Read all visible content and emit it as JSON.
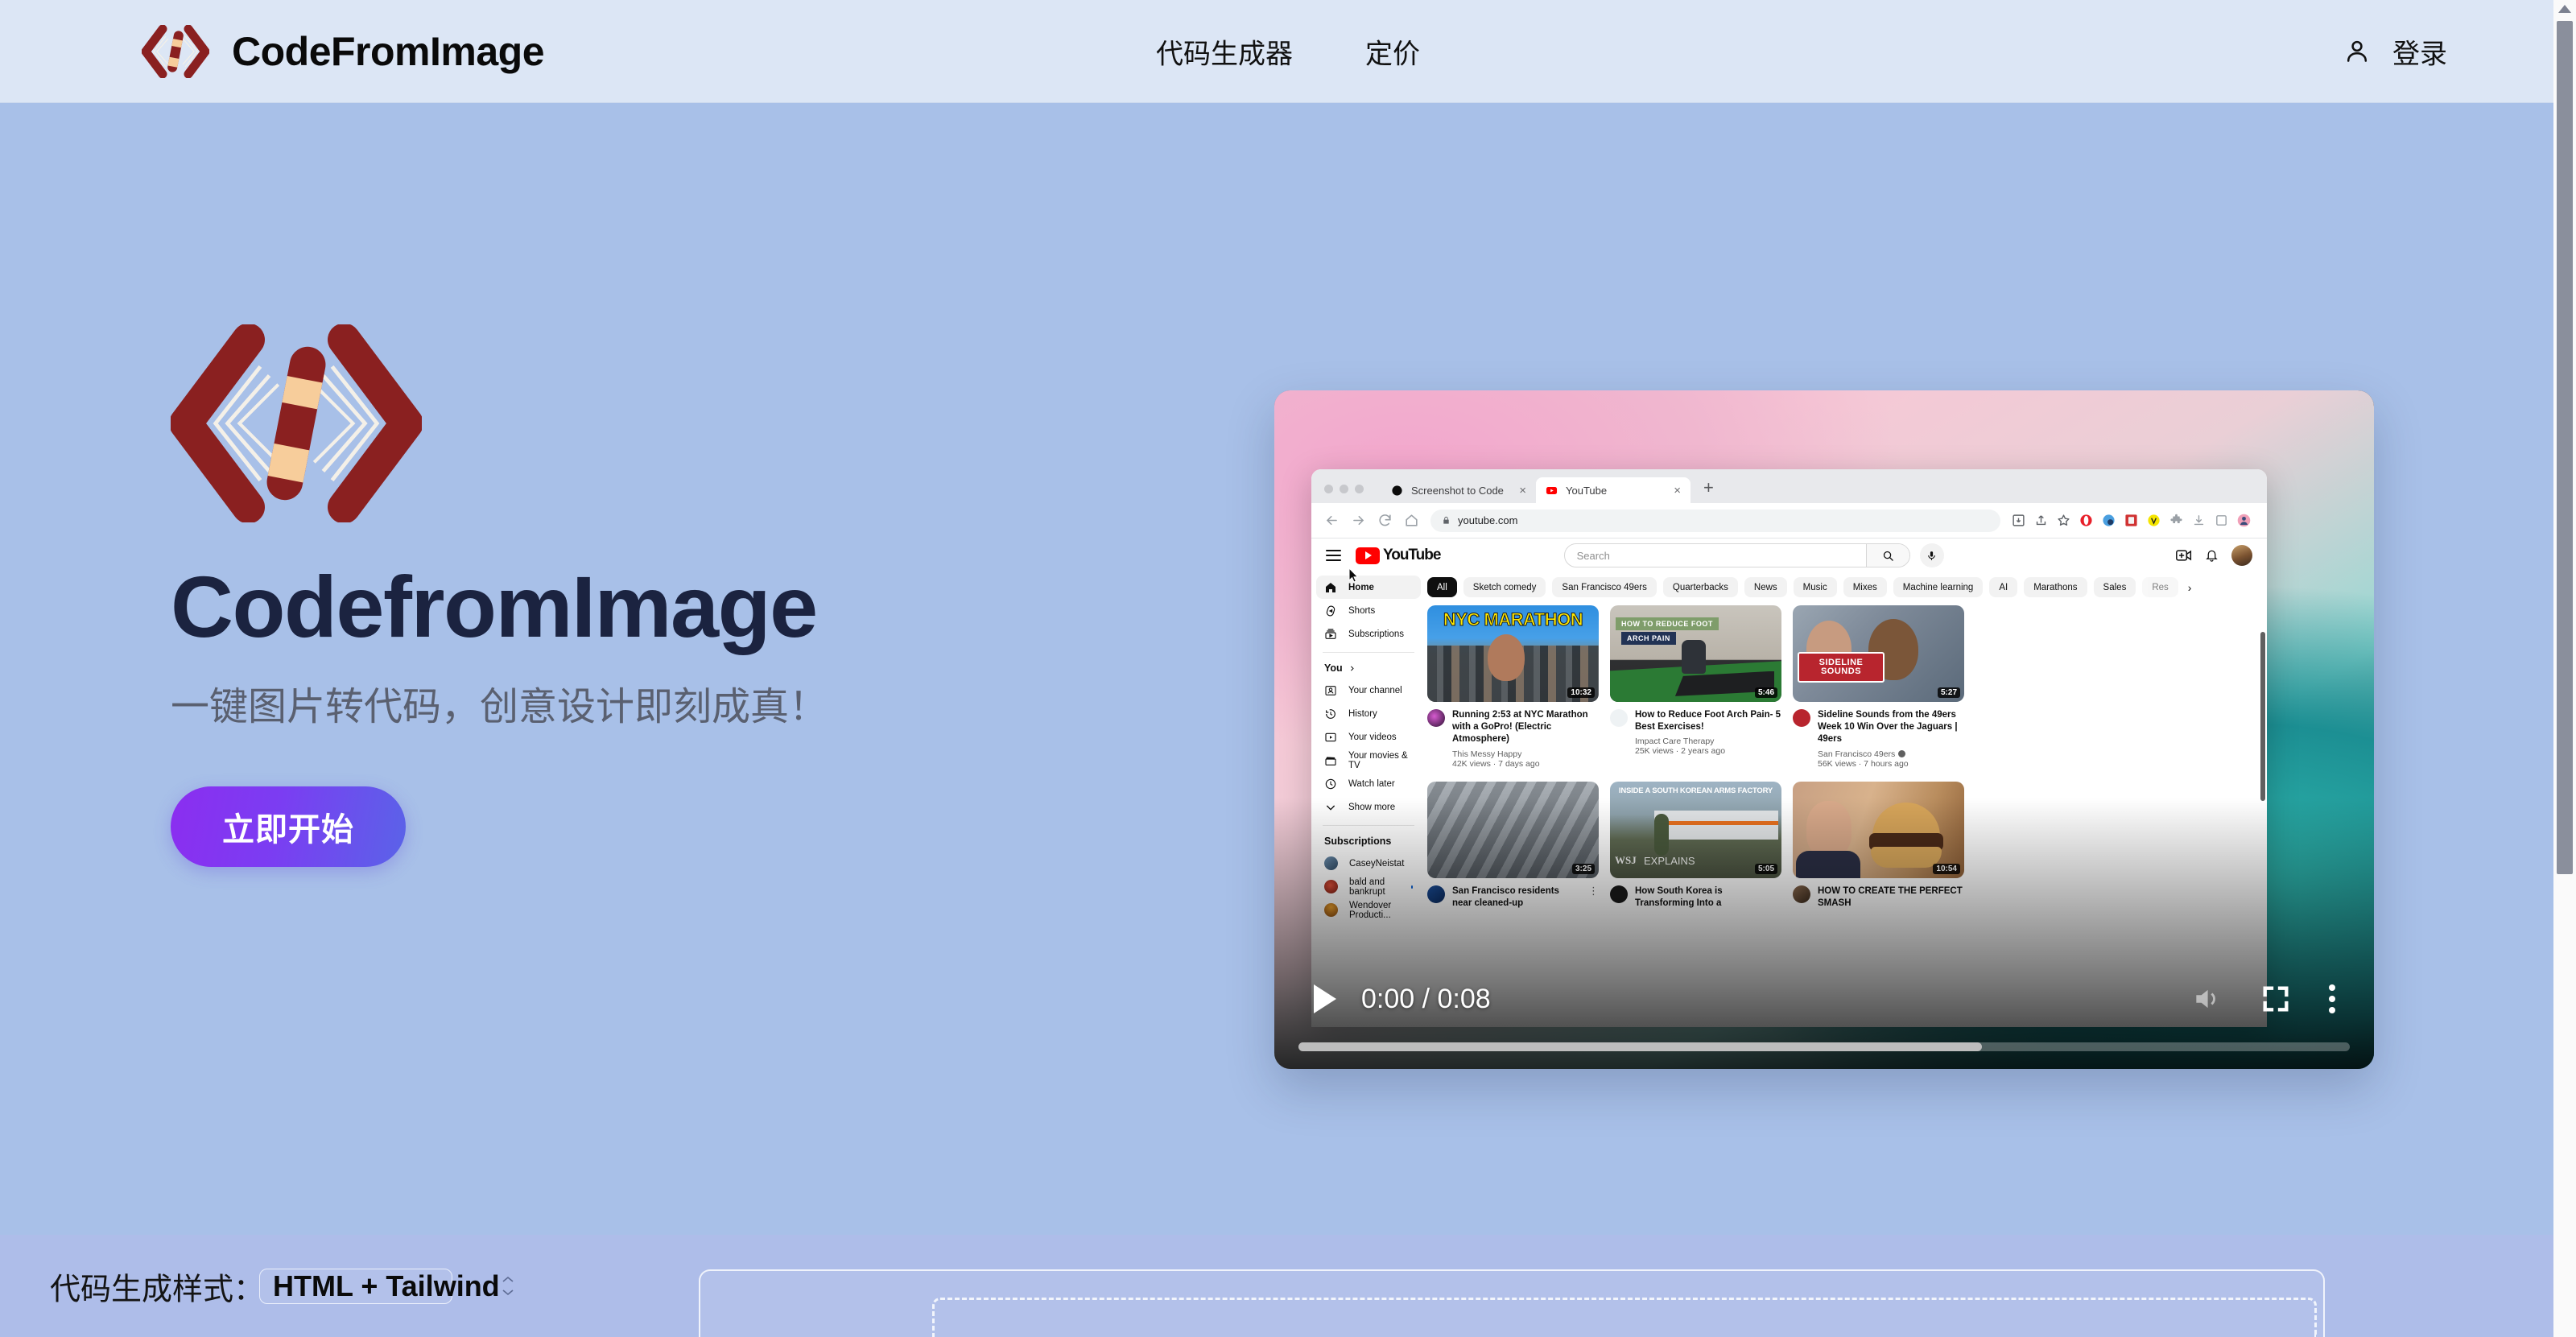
{
  "header": {
    "brand_name": "CodeFromImage",
    "logo_icon": "code-brackets-pencil-logo",
    "nav": [
      {
        "label": "代码生成器",
        "name": "nav-code-generator"
      },
      {
        "label": "定价",
        "name": "nav-pricing"
      }
    ],
    "login": {
      "label": "登录",
      "icon": "user-icon"
    }
  },
  "hero": {
    "logo_icon": "code-brackets-pencil-logo",
    "title": "CodefromImage",
    "subtitle": "一键图片转代码，创意设计即刻成真！",
    "cta_label": "立即开始"
  },
  "video": {
    "current_time": "0:00",
    "duration": "0:08",
    "time_display": "0:00 / 0:08",
    "progress_percent": 0,
    "buffered_percent": 65,
    "play_icon": "play-icon",
    "volume_icon": "volume-muted-icon",
    "fullscreen_icon": "fullscreen-icon",
    "menu_icon": "kebab-menu-icon",
    "browser": {
      "tabs": [
        {
          "title": "Screenshot to Code",
          "favicon": "black-circle-favicon",
          "active": false
        },
        {
          "title": "YouTube",
          "favicon": "youtube-favicon",
          "active": true
        }
      ],
      "new_tab_label": "+",
      "url": "youtube.com",
      "lock_icon": "lock-icon",
      "nav_icons": [
        "back-icon",
        "forward-icon",
        "reload-icon",
        "home-icon"
      ],
      "toolbar_icons": [
        "install-icon",
        "share-icon",
        "bookmark-star-icon",
        "opera-ext-icon",
        "privacy-ext-icon",
        "reader-ext-icon",
        "v-ext-icon",
        "puzzle-ext-icon",
        "download-icon",
        "sidebar-icon",
        "profile-avatar"
      ]
    },
    "youtube": {
      "logo_text": "YouTube",
      "menu_icon": "hamburger-menu-icon",
      "search_placeholder": "Search",
      "search_icon": "search-icon",
      "mic_icon": "microphone-icon",
      "create_icon": "create-video-icon",
      "bell_icon": "notifications-bell-icon",
      "avatar_icon": "account-avatar",
      "sidebar": [
        {
          "label": "Home",
          "icon": "home-icon",
          "active": true
        },
        {
          "label": "Shorts",
          "icon": "shorts-icon",
          "active": false
        },
        {
          "label": "Subscriptions",
          "icon": "subscriptions-icon",
          "active": false
        }
      ],
      "you_section": {
        "label": "You",
        "chevron": "chevron-right-icon"
      },
      "you_items": [
        {
          "label": "Your channel",
          "icon": "channel-icon"
        },
        {
          "label": "History",
          "icon": "history-icon"
        },
        {
          "label": "Your videos",
          "icon": "your-videos-icon"
        },
        {
          "label": "Your movies & TV",
          "icon": "movies-tv-icon"
        },
        {
          "label": "Watch later",
          "icon": "watch-later-icon"
        },
        {
          "label": "Show more",
          "icon": "chevron-down-icon"
        }
      ],
      "subscriptions_title": "Subscriptions",
      "subscriptions": [
        {
          "label": "CaseyNeistat",
          "new": false
        },
        {
          "label": "bald and bankrupt",
          "new": true
        },
        {
          "label": "Wendover Producti...",
          "new": false
        }
      ],
      "chips": [
        {
          "label": "All",
          "active": true
        },
        {
          "label": "Sketch comedy",
          "active": false
        },
        {
          "label": "San Francisco 49ers",
          "active": false
        },
        {
          "label": "Quarterbacks",
          "active": false
        },
        {
          "label": "News",
          "active": false
        },
        {
          "label": "Music",
          "active": false
        },
        {
          "label": "Mixes",
          "active": false
        },
        {
          "label": "Machine learning",
          "active": false
        },
        {
          "label": "AI",
          "active": false
        },
        {
          "label": "Marathons",
          "active": false
        },
        {
          "label": "Sales",
          "active": false
        },
        {
          "label": "Res",
          "active": false
        }
      ],
      "chips_next_icon": "chevron-right-icon",
      "videos_row1": [
        {
          "title": "Running 2:53 at NYC Marathon with a GoPro! (Electric Atmosphere)",
          "channel": "This Messy Happy",
          "stats": "42K views · 7 days ago",
          "duration": "10:32",
          "thumb_text": "NYC MARATHON",
          "verified": false
        },
        {
          "title": "How to Reduce Foot Arch Pain- 5 Best Exercises!",
          "channel": "Impact Care Therapy",
          "stats": "25K views · 2 years ago",
          "duration": "5:46",
          "thumb_text": "HOW TO REDUCE FOOT ARCH PAIN",
          "verified": false
        },
        {
          "title": "Sideline Sounds from the 49ers Week 10 Win Over the Jaguars | 49ers",
          "channel": "San Francisco 49ers",
          "stats": "56K views · 7 hours ago",
          "duration": "5:27",
          "thumb_text": "SIDELINE SOUNDS",
          "verified": true
        }
      ],
      "videos_row2": [
        {
          "title": "San Francisco residents near cleaned-up",
          "duration": "3:25",
          "thumb_text": ""
        },
        {
          "title": "How South Korea is Transforming Into a",
          "duration": "5:05",
          "thumb_text": "INSIDE A SOUTH KOREAN ARMS FACTORY"
        },
        {
          "title": "HOW TO CREATE THE PERFECT SMASH",
          "duration": "10:54",
          "thumb_text": ""
        }
      ]
    }
  },
  "bottom": {
    "style_label": "代码生成样式：",
    "style_value": "HTML + Tailwind",
    "stepper_icon": "chevron-up-down-icon"
  },
  "colors": {
    "header_bg": "#dce6f5",
    "body_bg": "#a8c0e8",
    "brand_dark_red": "#8a2020",
    "pencil_tan": "#f7cd9b",
    "cta_gradient_from": "#8b2ef0",
    "cta_gradient_to": "#5a63e8",
    "title_navy": "#1b2340",
    "subtitle_gray": "#5a6070",
    "bottom_bar_bg": "#aebde9"
  }
}
